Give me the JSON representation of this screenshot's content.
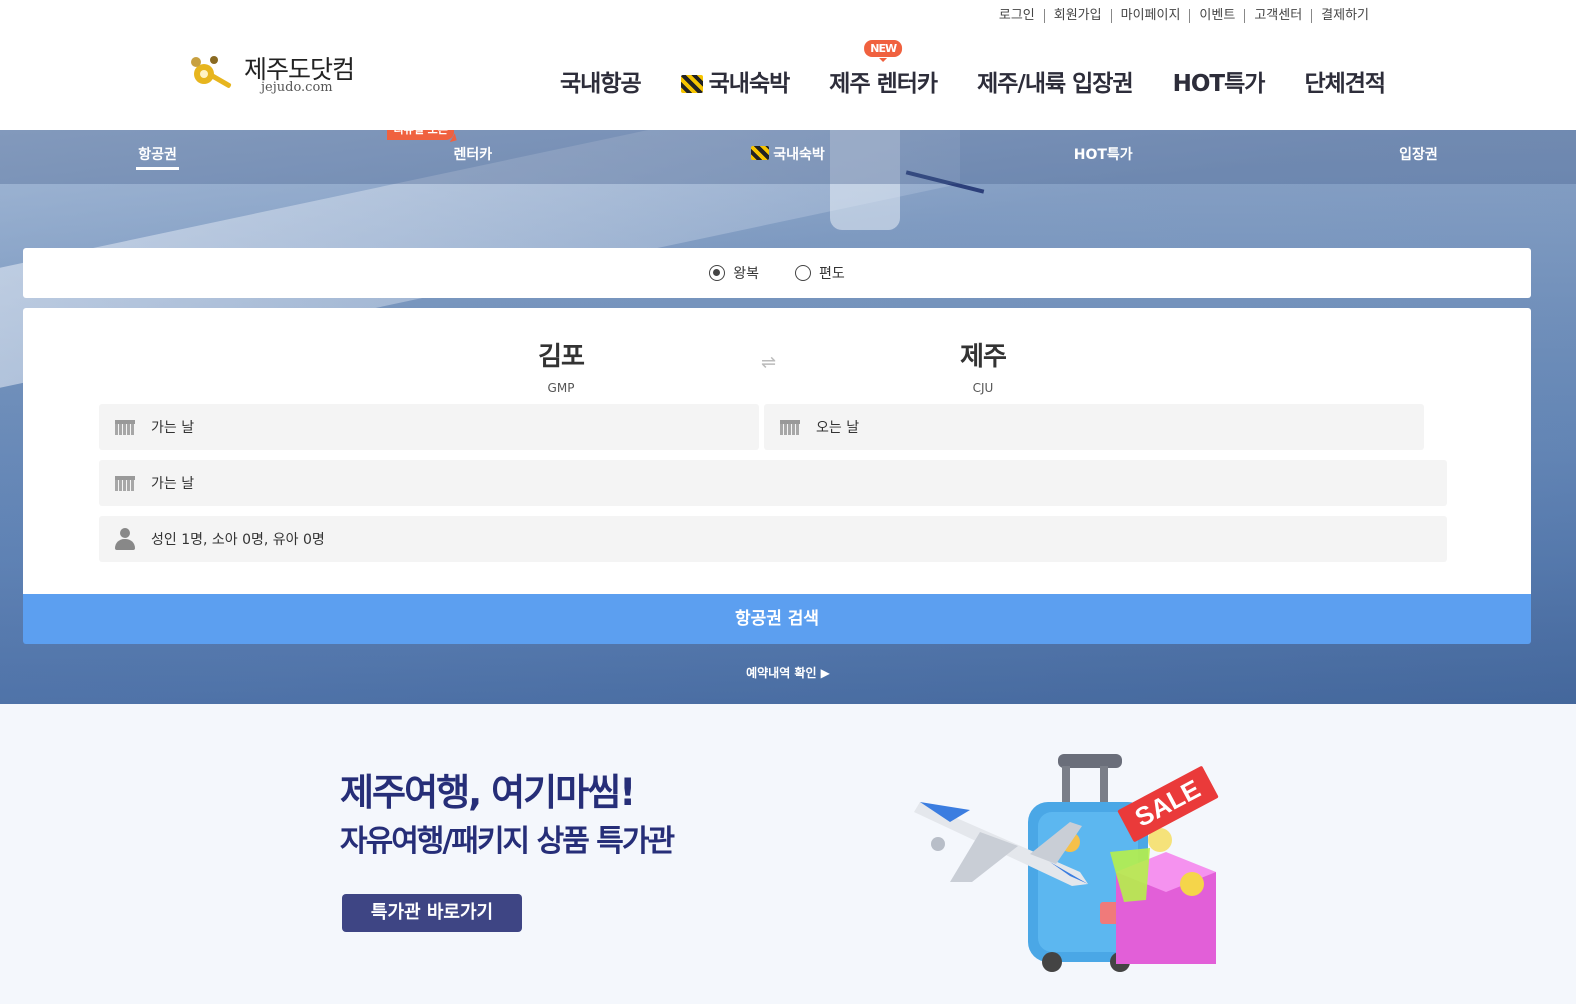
{
  "util_links": [
    "로그인",
    "회원가입",
    "마이페이지",
    "이벤트",
    "고객센터",
    "결제하기"
  ],
  "logo": {
    "text": "제주도닷컴",
    "sub": "jejudo.com"
  },
  "gnb": [
    {
      "label": "국내항공"
    },
    {
      "label": "국내숙박",
      "icon": "construction-icon"
    },
    {
      "label": "제주 렌터카",
      "badge": "NEW"
    },
    {
      "label": "제주/내륙 입장권"
    },
    {
      "label": "HOT특가"
    },
    {
      "label": "단체견적"
    }
  ],
  "subnav": [
    {
      "label": "항공권",
      "active": true
    },
    {
      "label": "렌터카",
      "badge": "리뉴얼 오픈"
    },
    {
      "label": "국내숙박",
      "icon": "construction-icon"
    },
    {
      "label": "HOT특가"
    },
    {
      "label": "입장권"
    }
  ],
  "trip_type": {
    "round": "왕복",
    "oneway": "편도",
    "selected": "왕복"
  },
  "route": {
    "from": {
      "name": "김포",
      "code": "GMP"
    },
    "to": {
      "name": "제주",
      "code": "CJU"
    },
    "swap": "⇌"
  },
  "fields": {
    "depart": "가는 날",
    "return": "오는 날",
    "depart2": "가는 날",
    "passengers": "성인 1명, 소아 0명, 유아 0명"
  },
  "search_button": "항공권 검색",
  "reservation_link": "예약내역 확인 ▶",
  "promo": {
    "title": "제주여행, 여기마씸!",
    "subtitle": "자유여행/패키지 상품 특가관",
    "button": "특가관 바로가기",
    "sale_tag": "SALE"
  },
  "colors": {
    "accent": "#5c9ff0",
    "badge": "#f0613f",
    "promo_text": "#262e78",
    "promo_button": "#3e4584"
  }
}
